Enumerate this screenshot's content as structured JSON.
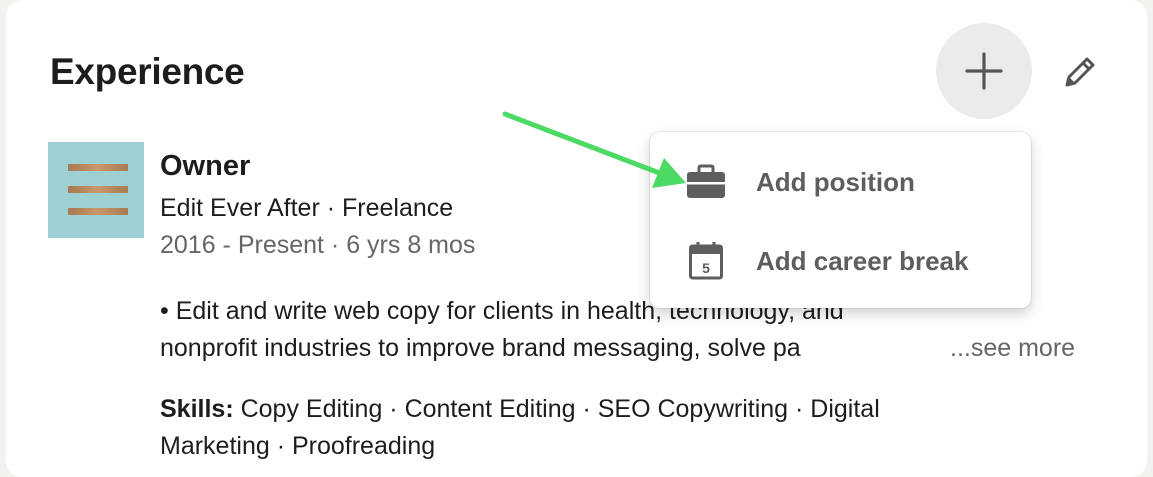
{
  "section": {
    "title": "Experience"
  },
  "header_actions": {
    "add_icon": "plus-icon",
    "edit_icon": "pencil-icon"
  },
  "experience": {
    "logo_icon": "company-logo-stripes",
    "title": "Owner",
    "company": "Edit Ever After · Freelance",
    "dates": "2016 - Present · 6 yrs 8 mos",
    "description_line1": "• Edit and write web copy for clients in health, technology, and",
    "description_line2": "nonprofit industries to improve brand messaging, solve pa",
    "see_more": "...see more",
    "skills_label": "Skills:",
    "skills_line1": " Copy Editing · Content Editing · SEO Copywriting · Digital",
    "skills_line2": "Marketing · Proofreading"
  },
  "dropdown": {
    "items": [
      {
        "label": "Add position",
        "icon": "briefcase-icon"
      },
      {
        "label": "Add career break",
        "icon": "calendar-icon",
        "icon_text": "5"
      }
    ]
  },
  "colors": {
    "arrow": "#4cd964",
    "logo_background": "#9ecfd3",
    "logo_stripes": "#b8875c"
  }
}
